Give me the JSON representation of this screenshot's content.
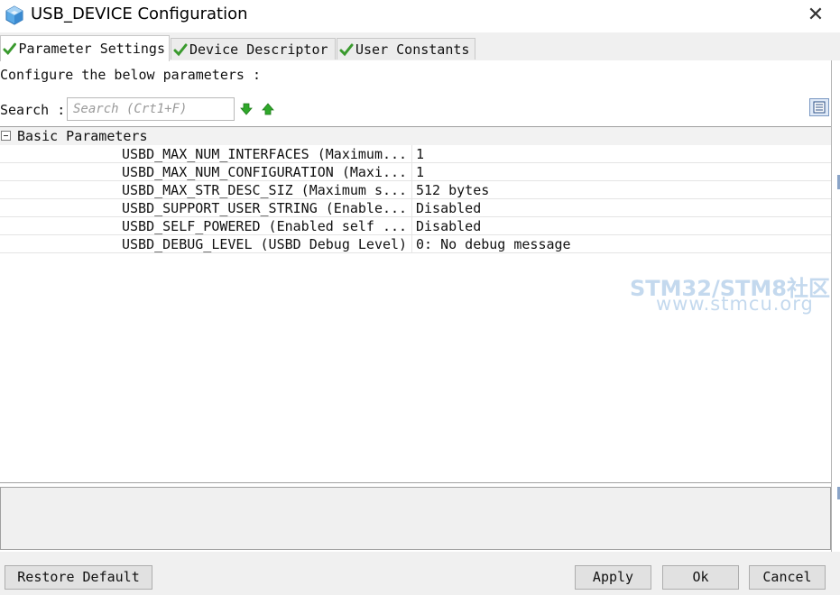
{
  "window": {
    "title": "USB_DEVICE Configuration",
    "close_icon": "close-icon"
  },
  "tabs": [
    {
      "label": "Parameter Settings",
      "active": true
    },
    {
      "label": "Device Descriptor",
      "active": false
    },
    {
      "label": "User Constants",
      "active": false
    }
  ],
  "configure_text": "Configure the below parameters :",
  "search": {
    "label": "Search :",
    "placeholder": "Search (Crt1+F)"
  },
  "tree": {
    "group_label": "Basic Parameters",
    "rows": [
      {
        "name": "USBD_MAX_NUM_INTERFACES (Maximum...",
        "value": "1"
      },
      {
        "name": "USBD_MAX_NUM_CONFIGURATION (Maxi...",
        "value": "1"
      },
      {
        "name": "USBD_MAX_STR_DESC_SIZ (Maximum s...",
        "value": "512 bytes"
      },
      {
        "name": "USBD_SUPPORT_USER_STRING (Enable...",
        "value": "Disabled"
      },
      {
        "name": "USBD_SELF_POWERED (Enabled self ...",
        "value": "Disabled"
      },
      {
        "name": "USBD_DEBUG_LEVEL (USBD Debug Level)",
        "value": "0: No debug message"
      }
    ]
  },
  "watermark": {
    "line1": "STM32/STM8社区",
    "line2": "www.stmcu.org"
  },
  "buttons": {
    "restore": "Restore Default",
    "apply": "Apply",
    "ok": "Ok",
    "cancel": "Cancel"
  },
  "colors": {
    "check_green": "#3a9a2e",
    "arrow_green": "#2fa82a",
    "watermark": "#c4d9ee"
  }
}
